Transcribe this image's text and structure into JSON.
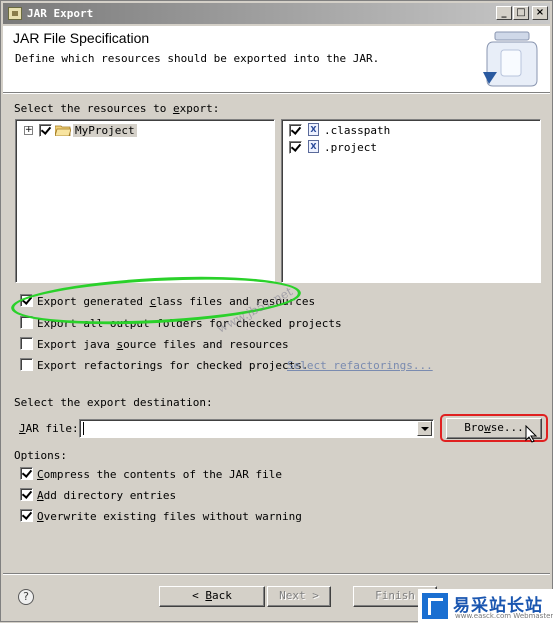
{
  "window": {
    "title": "JAR Export",
    "min_glyph": "_",
    "max_glyph": "□",
    "close_glyph": "×"
  },
  "header": {
    "title": "JAR File Specification",
    "description": "Define which resources should be exported into the JAR."
  },
  "resources": {
    "label_pre": "Select the resources to ",
    "label_key": "e",
    "label_post": "xport:",
    "tree": [
      {
        "label": "MyProject",
        "checked": true,
        "expandable": true,
        "icon": "project-folder-icon"
      }
    ],
    "files": [
      {
        "label": ".classpath",
        "checked": true,
        "icon": "xml-file-icon",
        "glyph": "X"
      },
      {
        "label": ".project",
        "checked": true,
        "icon": "xml-file-icon",
        "glyph": "X"
      }
    ]
  },
  "options_top": [
    {
      "pre": "Export generated ",
      "key": "c",
      "post": "lass files and resources",
      "checked": true
    },
    {
      "pre": "Export all output folders for checked projects",
      "key": "",
      "post": "",
      "checked": false
    },
    {
      "pre": "Export java ",
      "key": "s",
      "post": "ource files and resources",
      "checked": false
    },
    {
      "pre": "Export refactorings for checked projects.",
      "key": "",
      "post": "",
      "checked": false
    }
  ],
  "select_refactorings": "Select refactorings...",
  "destination": {
    "label": "Select the export destination:",
    "jar_label_key": "J",
    "jar_label_post": "AR file:",
    "jar_value": "",
    "browse_key": "w",
    "browse_pre": "Bro",
    "browse_post": "se..."
  },
  "options": {
    "label": "Options:",
    "items": [
      {
        "pre": "",
        "key": "C",
        "post": "ompress the contents of the JAR file",
        "checked": true
      },
      {
        "pre": "",
        "key": "A",
        "post": "dd directory entries",
        "checked": true
      },
      {
        "pre": "",
        "key": "O",
        "post": "verwrite existing files without warning",
        "checked": true
      }
    ]
  },
  "buttons": {
    "help": "?",
    "back_prefix": "< ",
    "back_key": "B",
    "back_post": "ack",
    "next": "Next >",
    "finish": "Finish"
  },
  "overlay": {
    "watermark": "www.jb51.net",
    "brand_name": "易采站长站",
    "brand_url": "www.easck.com Webmaster"
  },
  "colors": {
    "highlight_ellipse": "#2ad12a",
    "highlight_box": "#e02020",
    "brand_blue": "#1a56b0"
  }
}
